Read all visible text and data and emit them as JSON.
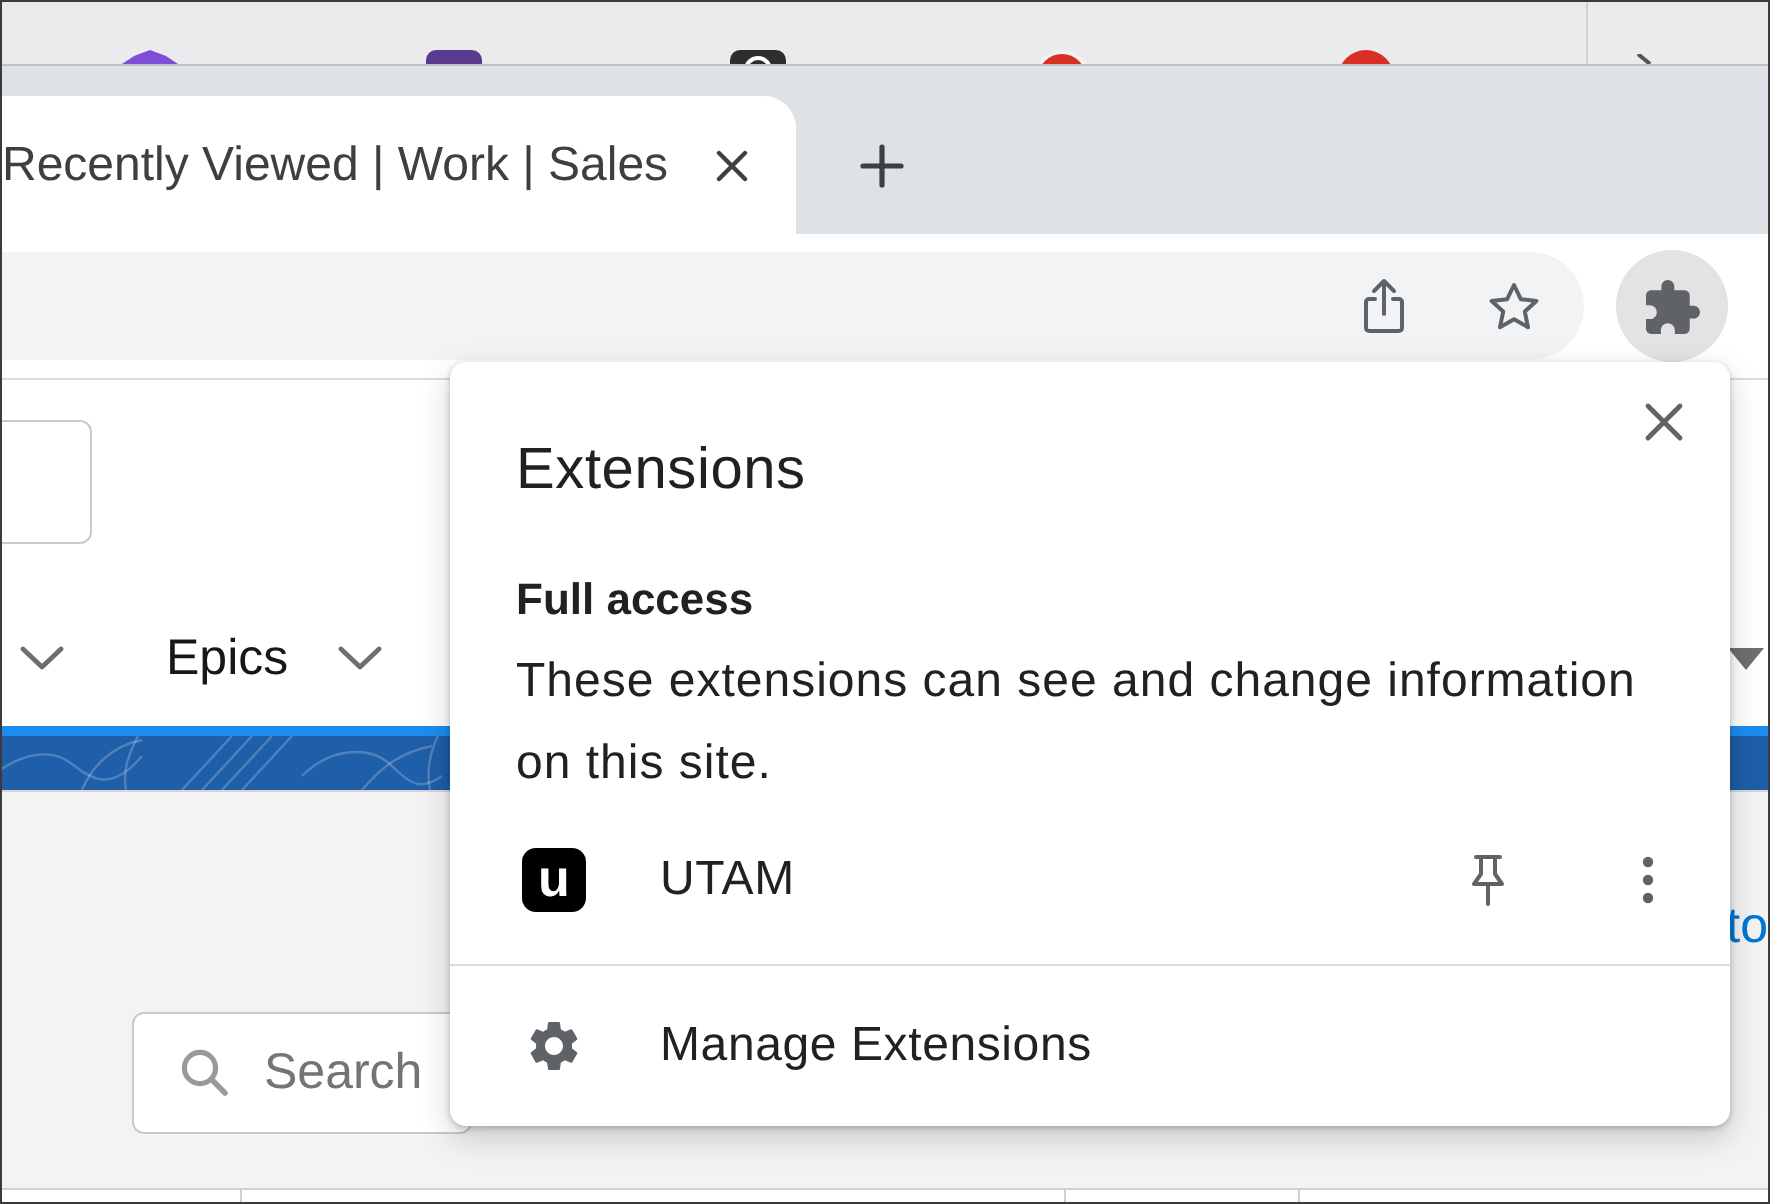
{
  "window": {
    "tabs": [
      {
        "title": "Recently Viewed | Work | Sales",
        "selected": true
      }
    ]
  },
  "page": {
    "nav_items": [
      {
        "label": "Epics"
      }
    ],
    "link": "to",
    "search": {
      "placeholder": "Search"
    }
  },
  "extensions_popup": {
    "title": "Extensions",
    "section": {
      "title": "Full access",
      "description": "These extensions can see and change information on this site."
    },
    "extensions": [
      {
        "name": "UTAM",
        "logo_text": "u",
        "pinned": false
      }
    ],
    "footer_item": "Manage Extensions"
  }
}
